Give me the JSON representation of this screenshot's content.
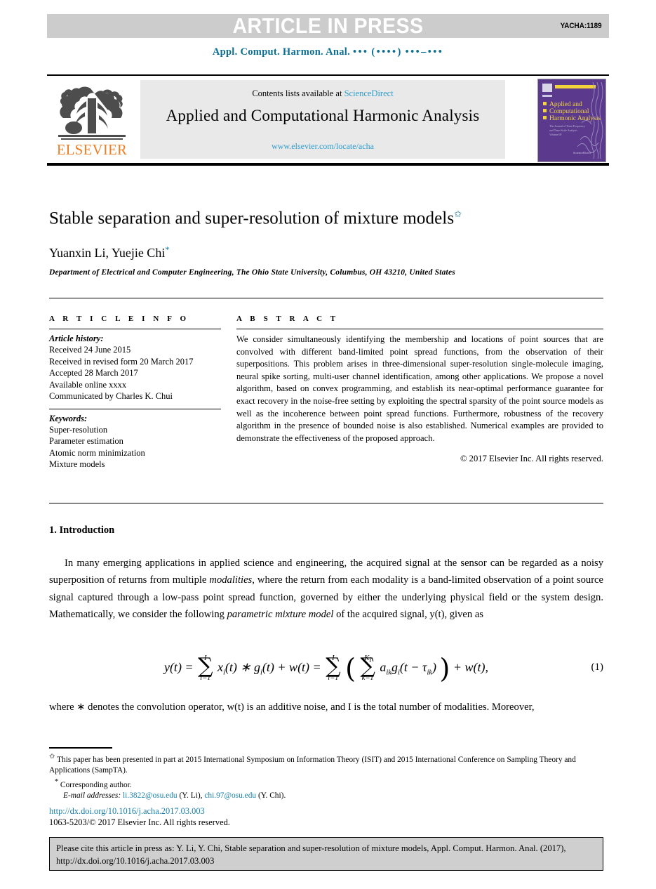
{
  "banner": {
    "label": "ARTICLE IN PRESS",
    "code": "YACHA:1189",
    "bg_color": "#cccccc",
    "text_color": "#ffffff"
  },
  "running_head": {
    "journal": "Appl. Comput. Harmon. Anal.",
    "volume_dots": "•••",
    "year_dots": "(••••)",
    "pages_dots": "•••–•••",
    "color": "#0b6e93"
  },
  "masthead": {
    "publisher": "ELSEVIER",
    "publisher_color": "#ef7d22",
    "contents_prefix": "Contents lists available at",
    "contents_link": "ScienceDirect",
    "journal_title": "Applied and Computational Harmonic Analysis",
    "journal_url": "www.elsevier.com/locate/acha",
    "link_color": "#2e9ccc",
    "cover": {
      "line1": "Applied and",
      "line2": "Computational",
      "line3": "Harmonic Analysis",
      "bg_color": "#5b3a8e",
      "accent_color": "#f2d33c"
    }
  },
  "article": {
    "title": "Stable separation and super-resolution of mixture models",
    "title_mark": "✩",
    "authors": "Yuanxin Li, Yuejie Chi",
    "author_mark": "*",
    "affiliation": "Department of Electrical and Computer Engineering, The Ohio State University, Columbus, OH 43210, United States"
  },
  "info": {
    "label": "A R T I C L E   I N F O",
    "history_heading": "Article history:",
    "history": [
      "Received 24 June 2015",
      "Received in revised form 20 March 2017",
      "Accepted 28 March 2017",
      "Available online xxxx",
      "Communicated by Charles K. Chui"
    ],
    "keywords_heading": "Keywords:",
    "keywords": [
      "Super-resolution",
      "Parameter estimation",
      "Atomic norm minimization",
      "Mixture models"
    ]
  },
  "abstract": {
    "label": "A B S T R A C T",
    "text": "We consider simultaneously identifying the membership and locations of point sources that are convolved with different band-limited point spread functions, from the observation of their superpositions. This problem arises in three-dimensional super-resolution single-molecule imaging, neural spike sorting, multi-user channel identification, among other applications. We propose a novel algorithm, based on convex programming, and establish its near-optimal performance guarantee for exact recovery in the noise-free setting by exploiting the spectral sparsity of the point source models as well as the incoherence between point spread functions. Furthermore, robustness of the recovery algorithm in the presence of bounded noise is also established. Numerical examples are provided to demonstrate the effectiveness of the proposed approach.",
    "copyright": "© 2017 Elsevier Inc. All rights reserved."
  },
  "body": {
    "section_number": "1.",
    "section_title": "Introduction",
    "paragraph1_a": "In many emerging applications in applied science and engineering, the acquired signal at the sensor can be regarded as a noisy superposition of returns from multiple ",
    "paragraph1_italic1": "modalities",
    "paragraph1_b": ", where the return from each modality is a band-limited observation of a point source signal captured through a low-pass point spread function, governed by either the underlying physical field or the system design. Mathematically, we consider the following ",
    "paragraph1_italic2": "parametric mixture model",
    "paragraph1_c": " of the acquired signal, y(t), given as",
    "paragraph2": "where ∗ denotes the convolution operator, w(t) is an additive noise, and I is the total number of modalities. Moreover,",
    "equation_number": "(1)"
  },
  "equation": {
    "lhs": "y(t) =",
    "sum1_upper": "I",
    "sum1_lower": "i=1",
    "term1": "x",
    "term1_sub": "i",
    "term1_rest": "(t) ∗ g",
    "term1_sub2": "i",
    "term1_tail": "(t) + w(t) =",
    "sum2_upper": "I",
    "sum2_lower": "i=1",
    "sum3_upper": "K",
    "sum3_upper_sub": "i",
    "sum3_lower": "k=1",
    "inner": "a",
    "inner_sub": "ik",
    "inner_g": "g",
    "inner_g_sub": "i",
    "inner_tail": "(t − τ",
    "inner_tau_sub": "ik",
    "inner_close": ")",
    "tail": "+ w(t),"
  },
  "footnotes": {
    "star_mark": "✩",
    "star_text": "This paper has been presented in part at 2015 International Symposium on Information Theory (ISIT) and 2015 International Conference on Sampling Theory and Applications (SampTA).",
    "corr_mark": "*",
    "corr_text": "Corresponding author.",
    "email_label": "E-mail addresses:",
    "email1": "li.3822@osu.edu",
    "email1_owner": "(Y. Li),",
    "email2": "chi.97@osu.edu",
    "email2_owner": "(Y. Chi).",
    "link_color": "#1a7fa8"
  },
  "doi": {
    "url": "http://dx.doi.org/10.1016/j.acha.2017.03.003",
    "issn_line": "1063-5203/© 2017 Elsevier Inc. All rights reserved."
  },
  "cite_box": {
    "text": "Please cite this article in press as: Y. Li, Y. Chi, Stable separation and super-resolution of mixture models, Appl. Comput. Harmon. Anal. (2017), http://dx.doi.org/10.1016/j.acha.2017.03.003",
    "bg_color": "#cfcfcf"
  }
}
